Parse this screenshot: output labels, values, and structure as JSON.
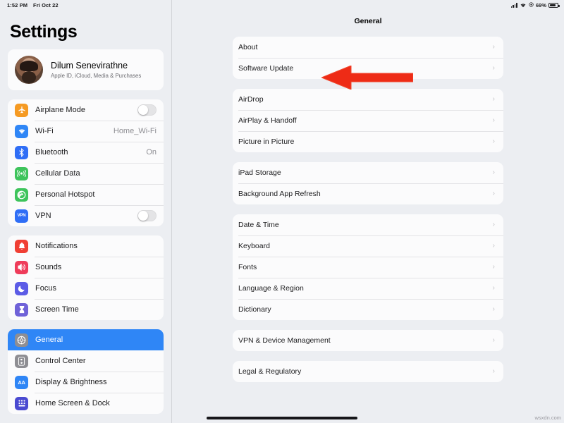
{
  "status_bar": {
    "time": "1:52 PM",
    "date": "Fri Oct 22",
    "signal_icon": "cellular-signal-icon",
    "wifi_icon": "wifi-icon",
    "location_icon": "location-arrow-icon",
    "battery_percent": "69%",
    "battery_icon": "battery-icon"
  },
  "sidebar": {
    "title": "Settings",
    "profile": {
      "name": "Dilum Senevirathne",
      "subtitle": "Apple ID, iCloud, Media & Purchases",
      "avatar": "user-avatar"
    },
    "groups": [
      {
        "items": [
          {
            "label": "Airplane Mode",
            "icon": "airplane-icon",
            "color": "#f59a23",
            "control": "toggle",
            "toggle_on": false,
            "value": ""
          },
          {
            "label": "Wi-Fi",
            "icon": "wifi-icon",
            "color": "#2f86f6",
            "control": "value",
            "value": "Home_Wi-Fi"
          },
          {
            "label": "Bluetooth",
            "icon": "bluetooth-icon",
            "color": "#2f6ef6",
            "control": "value",
            "value": "On"
          },
          {
            "label": "Cellular Data",
            "icon": "cellular-data-icon",
            "color": "#3ec45c",
            "control": "none",
            "value": ""
          },
          {
            "label": "Personal Hotspot",
            "icon": "hotspot-icon",
            "color": "#3ec45c",
            "control": "none",
            "value": ""
          },
          {
            "label": "VPN",
            "icon": "vpn-icon",
            "color": "#2f6ef6",
            "control": "toggle",
            "toggle_on": false,
            "value": ""
          }
        ]
      },
      {
        "items": [
          {
            "label": "Notifications",
            "icon": "notifications-bell-icon",
            "color": "#f03f34",
            "control": "none",
            "value": ""
          },
          {
            "label": "Sounds",
            "icon": "sounds-speaker-icon",
            "color": "#ef3c5a",
            "control": "none",
            "value": ""
          },
          {
            "label": "Focus",
            "icon": "focus-moon-icon",
            "color": "#5c5ce6",
            "control": "none",
            "value": ""
          },
          {
            "label": "Screen Time",
            "icon": "screen-time-hourglass-icon",
            "color": "#6f62d8",
            "control": "none",
            "value": ""
          }
        ]
      },
      {
        "items": [
          {
            "label": "General",
            "icon": "gear-icon",
            "color": "#8e8e93",
            "control": "none",
            "value": "",
            "selected": true
          },
          {
            "label": "Control Center",
            "icon": "control-center-icon",
            "color": "#8e8e93",
            "control": "none",
            "value": ""
          },
          {
            "label": "Display & Brightness",
            "icon": "display-brightness-aa-icon",
            "color": "#2f86f6",
            "control": "none",
            "value": ""
          },
          {
            "label": "Home Screen & Dock",
            "icon": "home-screen-dock-icon",
            "color": "#4a4ad1",
            "control": "none",
            "value": ""
          }
        ]
      }
    ]
  },
  "detail": {
    "title": "General",
    "chevron": "›",
    "groups": [
      {
        "items": [
          {
            "label": "About"
          },
          {
            "label": "Software Update"
          }
        ]
      },
      {
        "items": [
          {
            "label": "AirDrop"
          },
          {
            "label": "AirPlay & Handoff"
          },
          {
            "label": "Picture in Picture"
          }
        ]
      },
      {
        "items": [
          {
            "label": "iPad Storage"
          },
          {
            "label": "Background App Refresh"
          }
        ]
      },
      {
        "items": [
          {
            "label": "Date & Time"
          },
          {
            "label": "Keyboard"
          },
          {
            "label": "Fonts"
          },
          {
            "label": "Language & Region"
          },
          {
            "label": "Dictionary"
          }
        ]
      },
      {
        "items": [
          {
            "label": "VPN & Device Management"
          }
        ]
      },
      {
        "items": [
          {
            "label": "Legal & Regulatory"
          }
        ]
      }
    ]
  },
  "annotation": {
    "arrow_icon": "left-pointing-arrow-annotation",
    "arrow_color": "#ee2b16",
    "points_at": "Software Update"
  },
  "watermark": {
    "text": "wsxdn.com"
  },
  "home_indicator": "home-indicator-bar"
}
